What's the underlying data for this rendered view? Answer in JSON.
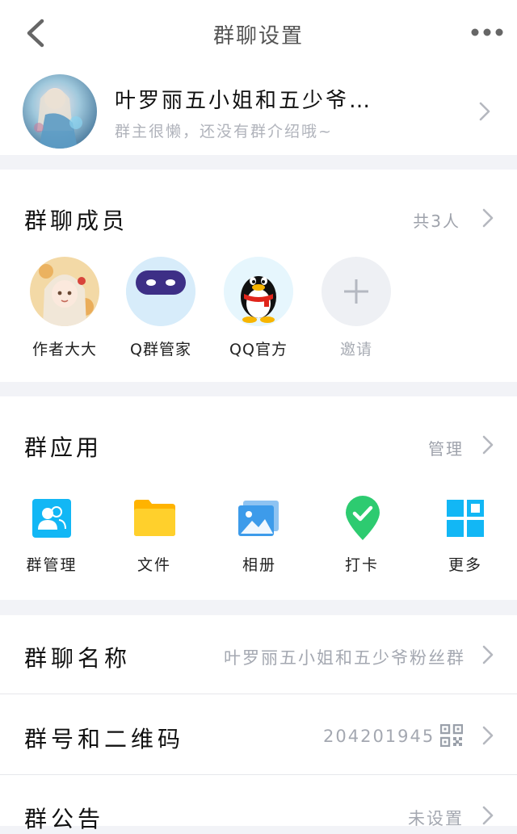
{
  "header": {
    "title": "群聊设置"
  },
  "group": {
    "name": "叶罗丽五小姐和五少爷…",
    "intro": "群主很懒，还没有群介绍哦~"
  },
  "members": {
    "title": "群聊成员",
    "count": "共3人",
    "items": [
      {
        "name": "作者大大"
      },
      {
        "name": "Q群管家"
      },
      {
        "name": "QQ官方"
      },
      {
        "name": "邀请"
      }
    ]
  },
  "apps": {
    "title": "群应用",
    "manage": "管理",
    "items": [
      {
        "name": "群管理",
        "icon": "group-manage-icon"
      },
      {
        "name": "文件",
        "icon": "folder-icon"
      },
      {
        "name": "相册",
        "icon": "album-icon"
      },
      {
        "name": "打卡",
        "icon": "checkin-icon"
      },
      {
        "name": "更多",
        "icon": "more-apps-icon"
      }
    ]
  },
  "settings": [
    {
      "title": "群聊名称",
      "value": "叶罗丽五小姐和五少爷粉丝群"
    },
    {
      "title": "群号和二维码",
      "value": "204201945"
    },
    {
      "title": "群公告",
      "value": "未设置"
    }
  ],
  "colors": {
    "accent": "#12b7f5",
    "folder": "#ffc30f",
    "checkin": "#2dcb70",
    "secondary_text": "#a4a8b1",
    "background": "#f2f3f7"
  }
}
